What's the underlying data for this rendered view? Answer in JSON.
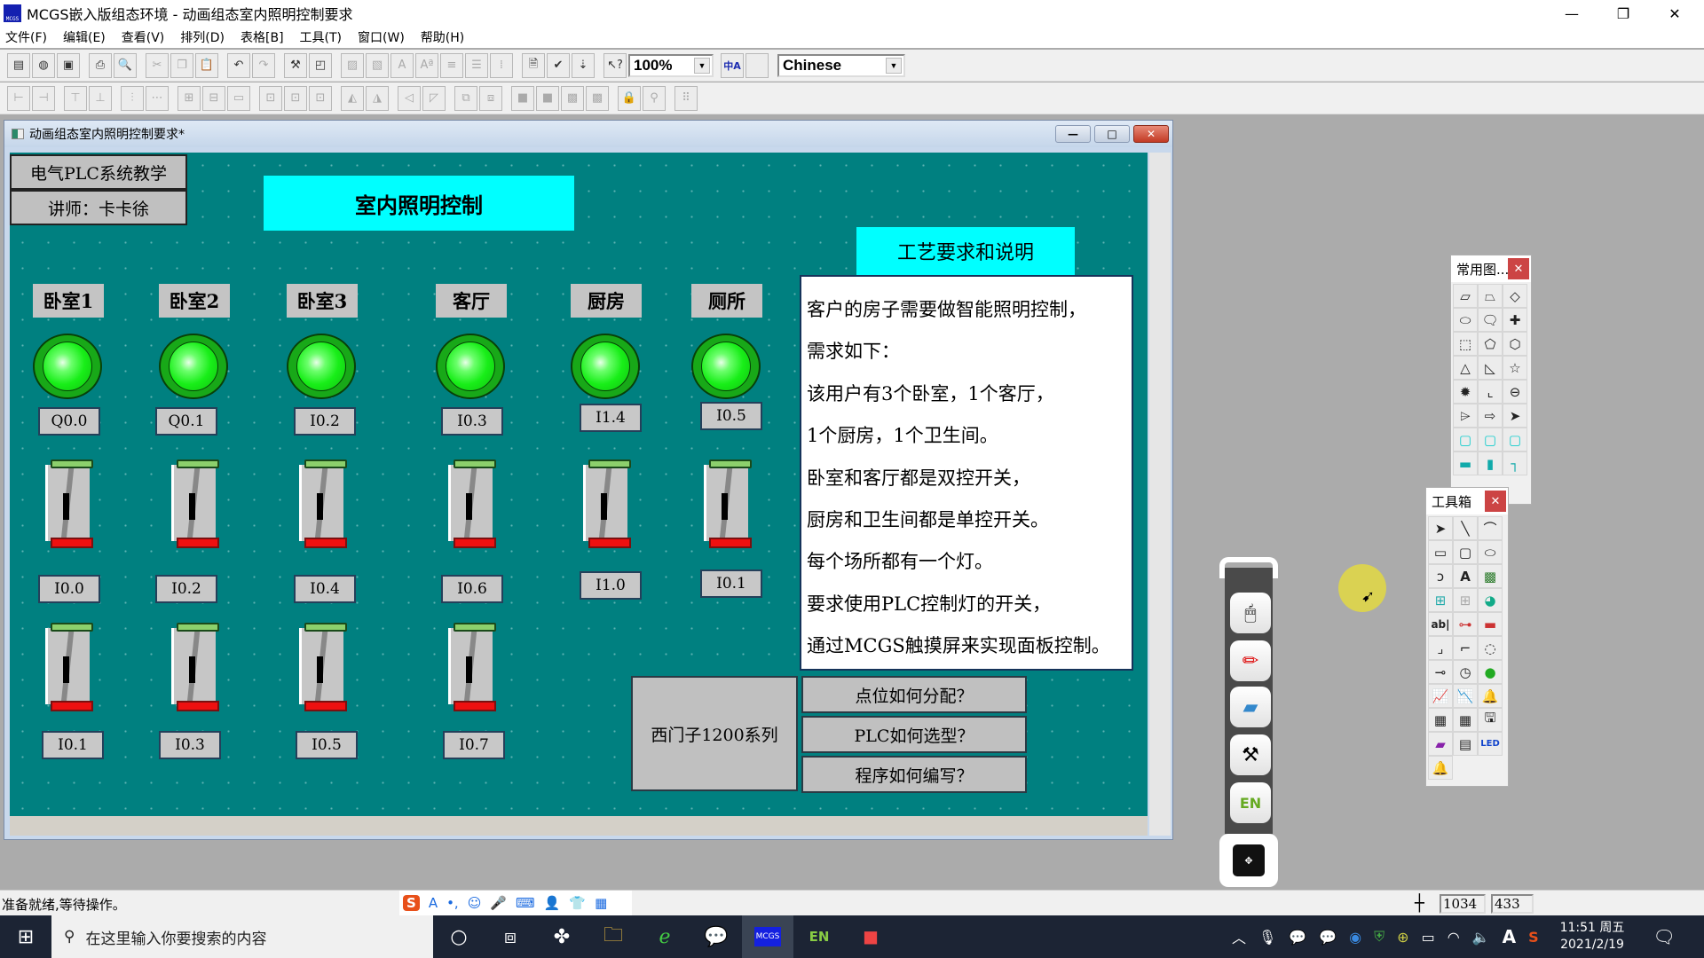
{
  "app": {
    "title": "MCGS嵌入版组态环境 - 动画组态室内照明控制要求",
    "icon_text": "MCGS"
  },
  "window_controls": {
    "minimize": "—",
    "maximize": "❐",
    "close": "✕"
  },
  "menu": [
    "文件(F)",
    "编辑(E)",
    "查看(V)",
    "排列(D)",
    "表格[B]",
    "工具(T)",
    "窗口(W)",
    "帮助(H)"
  ],
  "toolbar": {
    "zoom_value": "100%",
    "language_value": "Chinese",
    "lang_icon": "中A"
  },
  "child_window": {
    "title": "动画组态室内照明控制要求*",
    "min": "—",
    "max": "□",
    "close": "✕"
  },
  "canvas": {
    "course_label": "电气PLC系统教学",
    "teacher_label": "讲师：卡卡徐",
    "main_title": "室内照明控制",
    "desc_title": "工艺要求和说明",
    "rooms": [
      {
        "name": "卧室1",
        "lamp_addr": "Q0.0",
        "switch1": "I0.0",
        "switch2": "I0.1"
      },
      {
        "name": "卧室2",
        "lamp_addr": "Q0.1",
        "switch1": "I0.2",
        "switch2": "I0.3"
      },
      {
        "name": "卧室3",
        "lamp_addr": "I0.2",
        "switch1": "I0.4",
        "switch2": "I0.5"
      },
      {
        "name": "客厅",
        "lamp_addr": "I0.3",
        "switch1": "I0.6",
        "switch2": "I0.7"
      },
      {
        "name": "厨房",
        "lamp_addr": "I1.4",
        "switch1": "I1.0"
      },
      {
        "name": "厕所",
        "lamp_addr": "I0.5",
        "switch1": "I0.1"
      }
    ],
    "description": [
      "客户的房子需要做智能照明控制，",
      "需求如下：",
      "该用户有3个卧室，1个客厅，",
      "1个厨房，1个卫生间。",
      "卧室和客厅都是双控开关，",
      "厨房和卫生间都是单控开关。",
      "每个场所都有一个灯。",
      "要求使用PLC控制灯的开关，",
      "通过MCGS触摸屏来实现面板控制。"
    ],
    "plc_series": "西门子1200系列",
    "buttons": [
      "点位如何分配？",
      "PLC如何选型？",
      "程序如何编写？"
    ]
  },
  "panels": {
    "shapes_title": "常用图...",
    "toolbox_title": "工具箱"
  },
  "status": {
    "text": "准备就绪,等待操作。",
    "coord_x": "1034",
    "coord_y": "433"
  },
  "taskbar": {
    "search_placeholder": "在这里输入你要搜索的内容",
    "time": "11:51 周五",
    "date": "2021/2/19"
  }
}
